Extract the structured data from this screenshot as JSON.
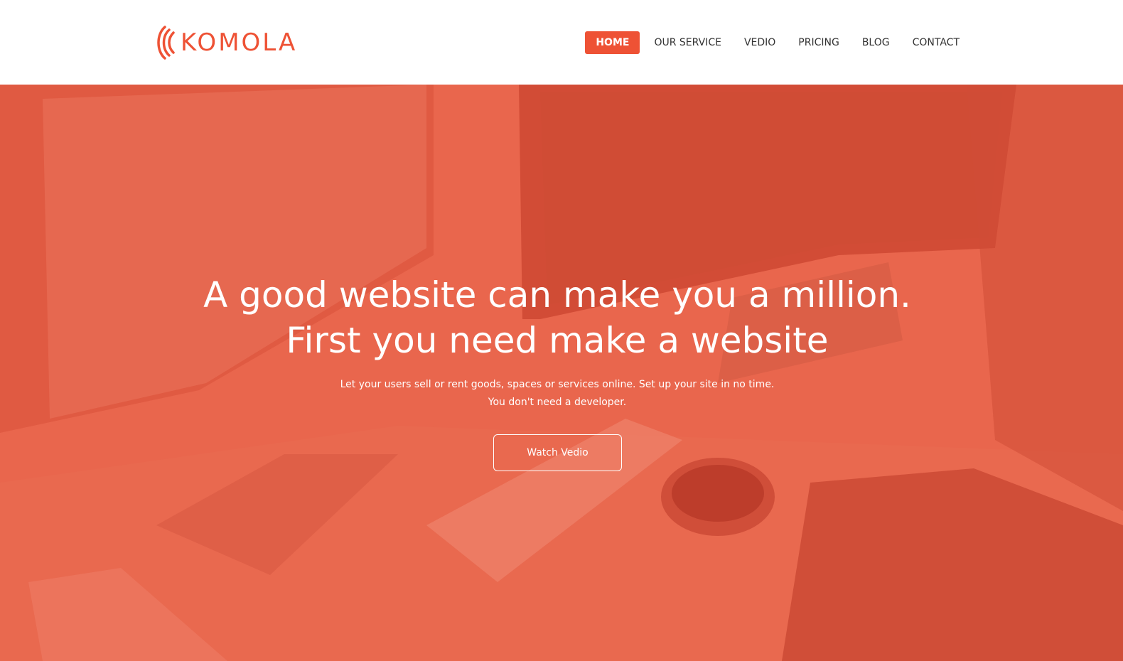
{
  "brand": {
    "name": "KOMOLA",
    "accent_color": "#ee5235",
    "hero_overlay_color": "#e8634b"
  },
  "nav": {
    "items": [
      {
        "label": "HOME",
        "active": true
      },
      {
        "label": "OUR SERVICE",
        "active": false
      },
      {
        "label": "VEDIO",
        "active": false
      },
      {
        "label": "PRICING",
        "active": false
      },
      {
        "label": "BLOG",
        "active": false
      },
      {
        "label": "CONTACT",
        "active": false
      }
    ]
  },
  "hero": {
    "title_line1": "A good website can make you a million.",
    "title_line2": "First you need make a website",
    "subtitle_line1": "Let your users sell or rent goods, spaces or services online. Set up your site in no time.",
    "subtitle_line2": "You don't need a developer.",
    "cta_label": "Watch Vedio"
  }
}
